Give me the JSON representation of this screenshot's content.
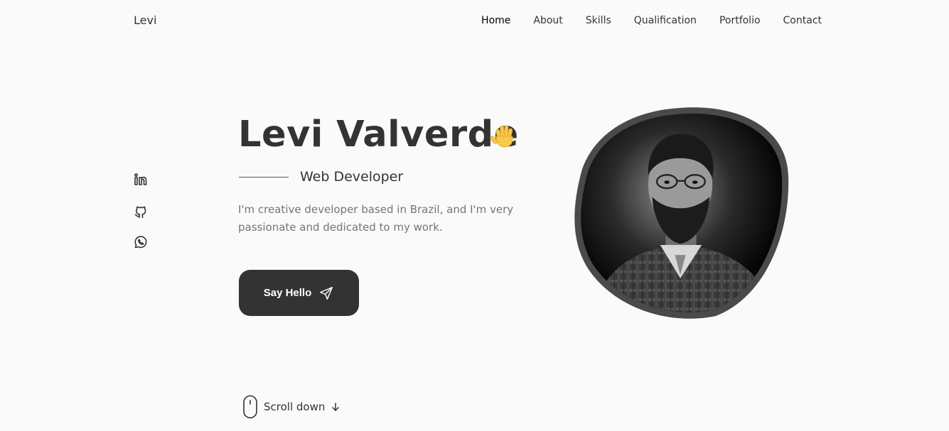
{
  "header": {
    "logo": "Levi",
    "nav": [
      {
        "label": "Home",
        "active": true
      },
      {
        "label": "About"
      },
      {
        "label": "Skills"
      },
      {
        "label": "Qualification"
      },
      {
        "label": "Portfolio"
      },
      {
        "label": "Contact"
      }
    ]
  },
  "social": [
    {
      "icon": "linkedin-icon"
    },
    {
      "icon": "github-icon"
    },
    {
      "icon": "whatsapp-icon"
    }
  ],
  "hero": {
    "title": "Levi Valverde",
    "title_emoji": "waving-hand-icon",
    "subtitle": "Web Developer",
    "description": "I'm creative developer based in Brazil, and I'm very passionate and dedicated to my work.",
    "cta_label": "Say Hello",
    "cta_icon": "send-icon"
  },
  "scroll": {
    "label": "Scroll down"
  },
  "colors": {
    "background": "#fafafa",
    "text": "#333333",
    "muted": "#757575",
    "button": "#333333",
    "blob_border": "#4a4a4a"
  }
}
